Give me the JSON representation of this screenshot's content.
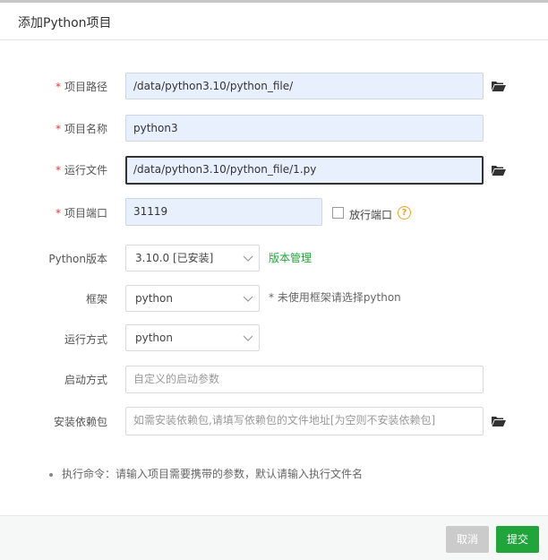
{
  "dialog": {
    "title": "添加Python项目"
  },
  "form": {
    "required_mark": "*",
    "project_path": {
      "label": "项目路径",
      "value": "/data/python3.10/python_file/"
    },
    "project_name": {
      "label": "项目名称",
      "value": "python3"
    },
    "run_file": {
      "label": "运行文件",
      "value": "/data/python3.10/python_file/1.py"
    },
    "project_port": {
      "label": "项目端口",
      "value": "31119",
      "release_port_label": "放行端口",
      "help_glyph": "?"
    },
    "python_version": {
      "label": "Python版本",
      "selected": "3.10.0 [已安装]",
      "manage_link": "版本管理"
    },
    "framework": {
      "label": "框架",
      "selected": "python",
      "note": "* 未使用框架请选择python"
    },
    "run_mode": {
      "label": "运行方式",
      "selected": "python"
    },
    "start_mode": {
      "label": "启动方式",
      "placeholder": "自定义的启动参数"
    },
    "install_deps": {
      "label": "安装依赖包",
      "placeholder": "如需安装依赖包,请填写依赖包的文件地址[为空则不安装依赖包]"
    }
  },
  "tip": {
    "text": "执行命令：请输入项目需要携带的参数，默认请输入执行文件名"
  },
  "footer": {
    "cancel_label": "取消",
    "submit_label": "提交"
  },
  "icons": {
    "folder": "folder-open-icon",
    "chevron": "chevron-down-icon"
  },
  "colors": {
    "accent": "#20a53a",
    "required": "#e4393c",
    "help": "#f0a020"
  }
}
